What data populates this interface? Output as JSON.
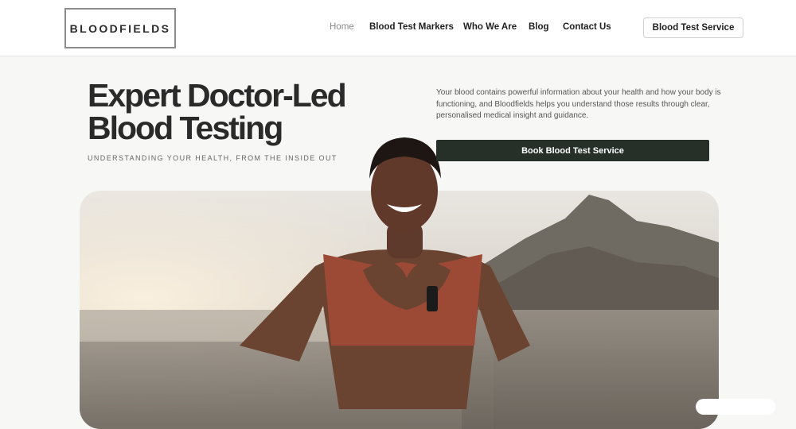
{
  "header": {
    "logo": "BLOODFIELDS",
    "nav": [
      {
        "label": "Home",
        "active": true
      },
      {
        "label": "Blood Test Markers",
        "active": false
      },
      {
        "label": "Who We Are",
        "active": false
      },
      {
        "label": "Blog",
        "active": false
      },
      {
        "label": "Contact Us",
        "active": false
      }
    ],
    "cta_label": "Blood Test Service"
  },
  "hero": {
    "headline_line1": "Expert Doctor-Led",
    "headline_line2": "Blood Testing",
    "tagline": "UNDERSTANDING YOUR HEALTH, FROM THE INSIDE OUT",
    "intro": "Your blood contains powerful information about your health and how your body is functioning, and Bloodfields helps you understand those results through clear, personalised medical insight and guidance.",
    "book_label": "Book Blood Test Service"
  },
  "colors": {
    "button_dark": "#263028",
    "nav_active": "#8a8a8a"
  }
}
